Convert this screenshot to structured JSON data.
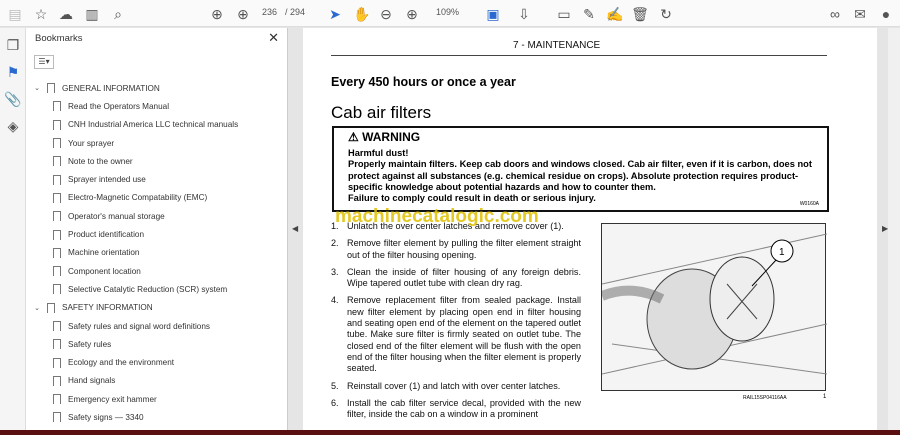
{
  "toolbar": {
    "page_current": "236",
    "page_total": "/ 294",
    "zoom": "109%"
  },
  "bookmarks": {
    "title": "Bookmarks",
    "items": [
      {
        "label": "GENERAL INFORMATION",
        "section": true
      },
      {
        "label": "Read the Operators Manual"
      },
      {
        "label": "CNH Industrial America LLC technical manuals"
      },
      {
        "label": "Your sprayer"
      },
      {
        "label": "Note to the owner"
      },
      {
        "label": "Sprayer intended use"
      },
      {
        "label": "Electro-Magnetic Compatability (EMC)"
      },
      {
        "label": "Operator's manual storage"
      },
      {
        "label": "Product identification"
      },
      {
        "label": "Machine orientation"
      },
      {
        "label": "Component location"
      },
      {
        "label": "Selective Catalytic Reduction (SCR) system"
      },
      {
        "label": "SAFETY INFORMATION",
        "section": true
      },
      {
        "label": "Safety rules and signal word definitions"
      },
      {
        "label": "Safety rules"
      },
      {
        "label": "Ecology and the environment"
      },
      {
        "label": "Hand signals"
      },
      {
        "label": "Emergency exit hammer"
      },
      {
        "label": "Safety signs — 3340"
      }
    ]
  },
  "page": {
    "header": "7 - MAINTENANCE",
    "interval": "Every 450 hours or once a year",
    "title": "Cab air filters",
    "warning": {
      "title": "WARNING",
      "lines": [
        "Harmful dust!",
        "Properly maintain filters. Keep cab doors and windows closed. Cab air filter, even if it is carbon, does not protect against all substances (e.g.  chemical residue on crops).  Absolute protection requires product-specific knowledge about potential hazards and how to counter them.",
        "Failure to comply could result in death or serious injury."
      ],
      "code": "W0160A"
    },
    "watermark": "machinecatalogic.com",
    "steps": [
      {
        "n": "1.",
        "text": "Unlatch the over center latches and remove cover (1)."
      },
      {
        "n": "2.",
        "text": "Remove filter element by pulling the filter element straight out of the filter housing opening."
      },
      {
        "n": "3.",
        "text": "Clean the inside of filter housing of any foreign debris. Wipe tapered outlet tube with clean dry rag."
      },
      {
        "n": "4.",
        "text": "Remove replacement filter from sealed package.  Install new filter element by placing open end in filter housing and seating open end of the element on the tapered outlet tube. Make sure filter is firmly seated on outlet tube. The closed end of the filter element will be flush with the open end of the filter housing when the filter element is properly seated."
      },
      {
        "n": "5.",
        "text": "Reinstall cover (1) and latch with over center latches."
      },
      {
        "n": "6.",
        "text": "Install the cab filter service decal, provided with the new filter, inside the cab on a window in a prominent"
      }
    ],
    "figure": {
      "callout": "1",
      "caption": "RAIL15SP04116AA",
      "number": "1"
    }
  }
}
